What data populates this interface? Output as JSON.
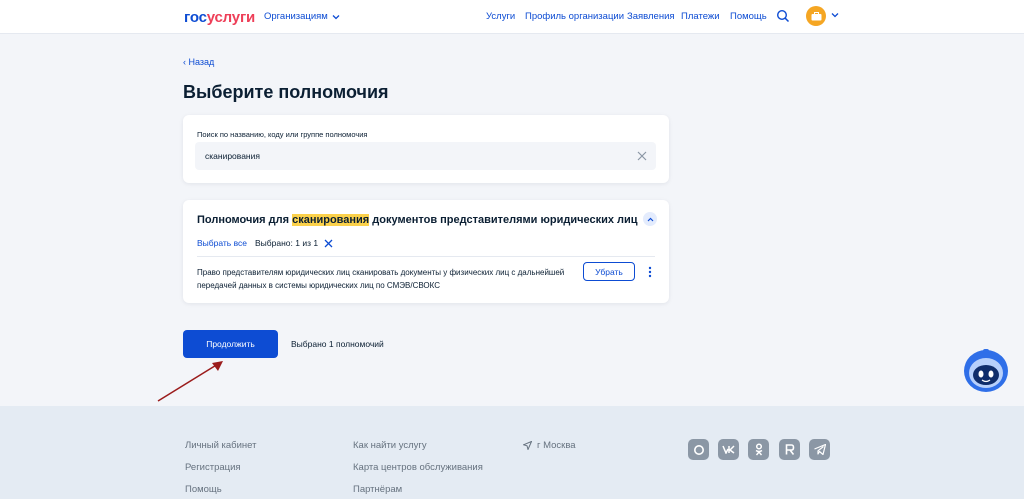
{
  "header": {
    "logo_part1": "гос",
    "logo_part2": "услуги",
    "org_menu_label": "Организациям",
    "nav": [
      "Услуги",
      "Профиль организации",
      "Заявления",
      "Платежи",
      "Помощь"
    ]
  },
  "back_label": "Назад",
  "page_title": "Выберите полномочия",
  "search": {
    "label": "Поиск по названию, коду или группе полномочия",
    "value": "сканирования"
  },
  "permission_group": {
    "title_before": "Полномочия для ",
    "title_highlight": "сканирования",
    "title_after": " документов представителями юридических лиц",
    "select_all_label": "Выбрать все",
    "selected_count": "Выбрано: 1 из 1",
    "item_description": "Право представителям юридических лиц сканировать документы у физических лиц с дальнейшей передачей данных в системы юридических лиц по СМЭВ/СВОКС",
    "remove_label": "Убрать"
  },
  "continue_label": "Продолжить",
  "selected_summary": "Выбрано 1 полномочий",
  "footer": {
    "col1": [
      "Личный кабинет",
      "Регистрация",
      "Помощь"
    ],
    "col2": [
      "Как найти услугу",
      "Карта центров обслуживания",
      "Партнёрам"
    ],
    "city": "г Москва"
  },
  "colors": {
    "primary": "#0d4cd3",
    "logo_red": "#ee3f58",
    "highlight": "#fbd14b",
    "page_bg": "#f3f5f9",
    "footer_bg": "#e4ebf3",
    "annotation_arrow": "#9b1c1c"
  }
}
